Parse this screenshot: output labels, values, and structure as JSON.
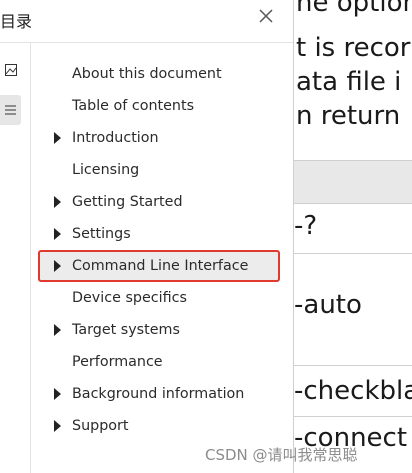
{
  "panel": {
    "title": "目录",
    "close_icon": "close-icon",
    "rail": [
      {
        "name": "image-icon",
        "active": false
      },
      {
        "name": "list-icon",
        "active": true
      }
    ],
    "items": [
      {
        "label": "About this document",
        "expandable": false
      },
      {
        "label": "Table of contents",
        "expandable": false
      },
      {
        "label": "Introduction",
        "expandable": true
      },
      {
        "label": "Licensing",
        "expandable": false
      },
      {
        "label": "Getting Started",
        "expandable": true
      },
      {
        "label": "Settings",
        "expandable": true
      },
      {
        "label": "Command Line Interface",
        "expandable": true,
        "selected": true
      },
      {
        "label": "Device specifics",
        "expandable": false
      },
      {
        "label": "Target systems",
        "expandable": true
      },
      {
        "label": "Performance",
        "expandable": false
      },
      {
        "label": "Background information",
        "expandable": true
      },
      {
        "label": "Support",
        "expandable": true
      }
    ]
  },
  "document": {
    "lines": [
      "he option",
      "t is recor",
      "ata file i",
      "n return"
    ],
    "table_rows": [
      "-?",
      "-auto",
      "-checkbla",
      "-connect"
    ]
  },
  "watermark": "CSDN @请叫我常思聪",
  "colors": {
    "selection_border": "#e03a2f",
    "selection_bg": "#ececec"
  }
}
